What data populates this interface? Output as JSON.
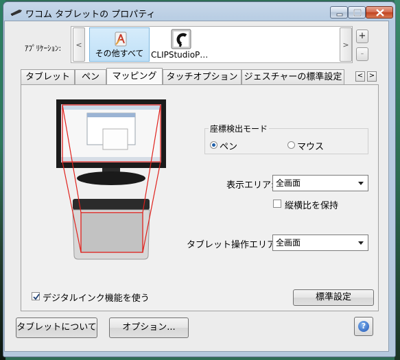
{
  "window": {
    "title": "ワコム タブレットの プロパティ"
  },
  "app_bar": {
    "label": "ｱﾌﾟﾘｹｰｼｮﾝ:",
    "apps": [
      {
        "label": "その他すべて",
        "selected": true
      },
      {
        "label": "CLIPStudioP…",
        "selected": false
      }
    ],
    "scroll_left": "<",
    "scroll_right": ">",
    "add": "+",
    "remove": "-"
  },
  "tabs": [
    {
      "label": "タブレット",
      "active": false
    },
    {
      "label": "ペン",
      "active": false
    },
    {
      "label": "マッピング",
      "active": true
    },
    {
      "label": "タッチオプション",
      "active": false
    },
    {
      "label": "ジェスチャーの標準設定",
      "active": false
    }
  ],
  "tab_scroll": {
    "left": "<",
    "right": ">"
  },
  "mapping": {
    "mode_group_title": "座標検出モード",
    "mode_pen": "ペン",
    "mode_mouse": "マウス",
    "mode_selected": "ペン",
    "display_area_label": "表示エリア:",
    "display_area_value": "全画面",
    "keep_aspect_label": "縦横比を保持",
    "keep_aspect_checked": false,
    "tablet_area_label": "タブレット操作エリア:",
    "tablet_area_value": "全画面",
    "digital_ink_label": "デジタルインク機能を使う",
    "digital_ink_checked": true,
    "default_button": "標準設定"
  },
  "footer": {
    "about_button": "タブレットについて",
    "options_button": "オプション...",
    "help_icon": "?"
  },
  "colors": {
    "accent": "#1f5fa8",
    "mapping_lines": "#e0201b"
  }
}
